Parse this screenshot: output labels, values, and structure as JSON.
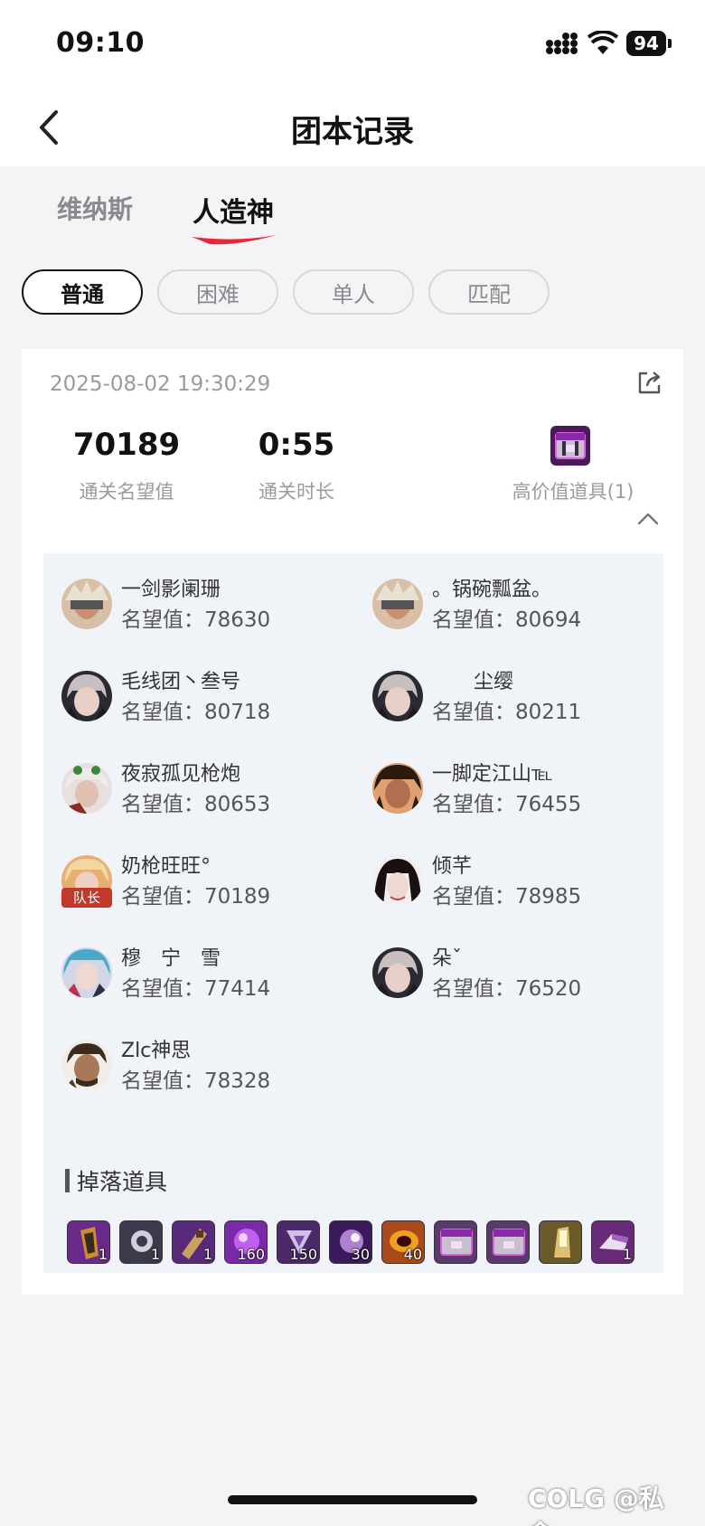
{
  "status_bar": {
    "time": "09:10",
    "battery": "94"
  },
  "nav": {
    "title": "团本记录"
  },
  "tabs": [
    {
      "label": "维纳斯",
      "active": false
    },
    {
      "label": "人造神",
      "active": true
    }
  ],
  "modes": [
    {
      "label": "普通",
      "active": true
    },
    {
      "label": "困难",
      "active": false
    },
    {
      "label": "单人",
      "active": false
    },
    {
      "label": "匹配",
      "active": false
    }
  ],
  "record": {
    "datetime": "2025-08-02 19:30:29",
    "reputation_value": "70189",
    "reputation_label": "通关名望值",
    "duration_value": "0:55",
    "duration_label": "通关时长",
    "valuable_label": "高价值道具(1)"
  },
  "members": [
    {
      "name": "一剑影阑珊",
      "rep": "名望值：78630"
    },
    {
      "name": "。锅碗瓢盆。",
      "rep": "名望值：80694"
    },
    {
      "name": "毛线团丶叁号",
      "rep": "名望值：80718"
    },
    {
      "name": "尘缨",
      "rep": "名望值：80211"
    },
    {
      "name": "夜寂孤见枪炮",
      "rep": "名望值：80653"
    },
    {
      "name": "一脚定江山℡",
      "rep": "名望值：76455"
    },
    {
      "name": "奶枪旺旺°",
      "rep": "名望值：70189",
      "badge": "队长"
    },
    {
      "name": "倾芊",
      "rep": "名望值：78985"
    },
    {
      "name": "穆　宁　雪",
      "rep": "名望值：77414"
    },
    {
      "name": "朵ˇ",
      "rep": "名望值：76520"
    },
    {
      "name": "Zlc神思",
      "rep": "名望值：78328"
    }
  ],
  "drops": {
    "title": "掉落道具",
    "items": [
      {
        "count": "1",
        "color": "#6a2a8a"
      },
      {
        "count": "1",
        "color": "#3a3a4a"
      },
      {
        "count": "1",
        "color": "#5a2a7a"
      },
      {
        "count": "160",
        "color": "#7a2aa8"
      },
      {
        "count": "150",
        "color": "#4a2a6a"
      },
      {
        "count": "30",
        "color": "#3a1a5a"
      },
      {
        "count": "40",
        "color": "#a84a1a"
      },
      {
        "count": "",
        "color": "#5a3a6a"
      },
      {
        "count": "",
        "color": "#5a3a6a"
      },
      {
        "count": "",
        "color": "#6a5a2a"
      },
      {
        "count": "1",
        "color": "#6a2a7a"
      }
    ]
  },
  "watermark": "COLG @私念、"
}
